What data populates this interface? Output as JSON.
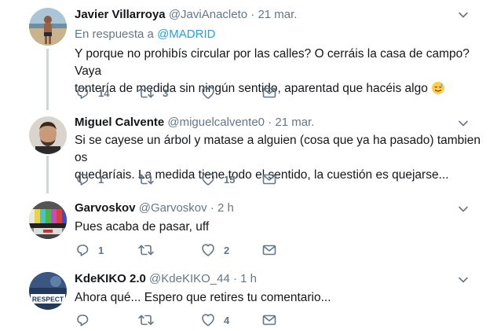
{
  "colors": {
    "link": "#1da1f2",
    "muted": "#657786",
    "text": "#14171a",
    "thread_line": "#ccd6dd"
  },
  "tweets": [
    {
      "name": "Javier Villarroya",
      "handle": "@JaviAnacleto",
      "separator": "·",
      "time": "21 mar.",
      "reply_prefix": "En respuesta a",
      "reply_mention": "@MADRID",
      "text_line1": "Y porque no prohibís circular por las calles? O cerráis la casa de campo? Vaya",
      "text_line2": "tontería de medida sin ningún sentido, aparentad que hacéis algo",
      "emoji": "smiling-face-with-sweat-icon",
      "replies": "14",
      "retweets": "3",
      "likes": ""
    },
    {
      "name": "Miguel Calvente",
      "handle": "@miguelcalvente0",
      "separator": "·",
      "time": "21 mar.",
      "text_line1": "Si se cayese un árbol y matase a alguien (cosa que ya ha pasado) tambien os",
      "text_line2": "quedaríais. La medida tiene todo el sentido, la cuestión es quejarse...",
      "replies": "1",
      "retweets": "",
      "likes": "15"
    },
    {
      "name": "Garvoskov",
      "handle": "@Garvoskov",
      "separator": "·",
      "time": "2 h",
      "text_line1": "Pues acaba de pasar, uff",
      "replies": "1",
      "retweets": "",
      "likes": "2"
    },
    {
      "name": "KdeKIKO 2.0",
      "handle": "@KdeKIKO_44",
      "separator": "·",
      "time": "1 h",
      "text_line1": "Ahora qué... Espero que retires tu comentario...",
      "avatar_text": "RESPECT",
      "replies": "",
      "retweets": "",
      "likes": "4"
    }
  ]
}
